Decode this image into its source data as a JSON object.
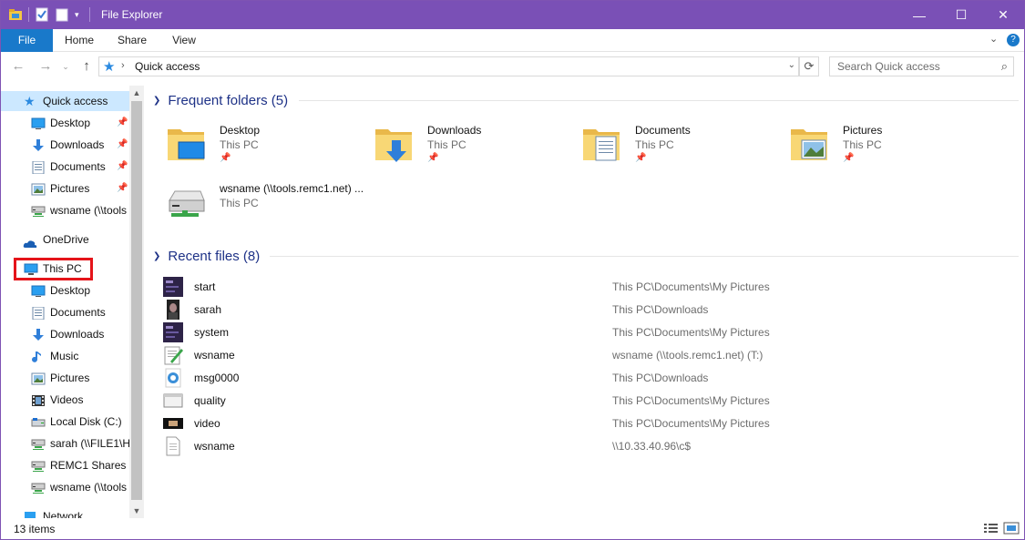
{
  "window": {
    "title": "File Explorer",
    "accent": "#7a50b6",
    "file_tab_color": "#1979ca",
    "highlight_color": "#e5141a",
    "controls": {
      "minimize": "—",
      "maximize": "☐",
      "close": "✕"
    }
  },
  "ribbon": {
    "tabs": [
      "File",
      "Home",
      "Share",
      "View"
    ],
    "expand_glyph": "⌄",
    "help_glyph": "?"
  },
  "address": {
    "path": "Quick access",
    "separator": "›",
    "search_placeholder": "Search Quick access"
  },
  "nav": {
    "quick_access": "Quick access",
    "qa_items": [
      {
        "label": "Desktop",
        "icon": "desktop-icon",
        "pinned": true
      },
      {
        "label": "Downloads",
        "icon": "downloads-icon",
        "pinned": true
      },
      {
        "label": "Documents",
        "icon": "documents-icon",
        "pinned": true
      },
      {
        "label": "Pictures",
        "icon": "pictures-icon",
        "pinned": true
      },
      {
        "label": "wsname (\\\\tools",
        "icon": "network-drive-icon",
        "pinned": false
      }
    ],
    "onedrive": "OneDrive",
    "this_pc": "This PC",
    "pc_items": [
      {
        "label": "Desktop",
        "icon": "desktop-icon"
      },
      {
        "label": "Documents",
        "icon": "documents-icon"
      },
      {
        "label": "Downloads",
        "icon": "downloads-icon"
      },
      {
        "label": "Music",
        "icon": "music-icon"
      },
      {
        "label": "Pictures",
        "icon": "pictures-icon"
      },
      {
        "label": "Videos",
        "icon": "videos-icon"
      },
      {
        "label": "Local Disk (C:)",
        "icon": "local-disk-icon"
      },
      {
        "label": "sarah (\\\\FILE1\\H",
        "icon": "network-drive-icon"
      },
      {
        "label": "REMC1 Shares (S",
        "icon": "network-drive-icon"
      },
      {
        "label": "wsname (\\\\tools",
        "icon": "network-drive-icon"
      }
    ],
    "network": "Network"
  },
  "frequent": {
    "title": "Frequent folders (5)",
    "folders": [
      {
        "name": "Desktop",
        "location": "This PC",
        "icon": "desktop-folder-icon"
      },
      {
        "name": "Downloads",
        "location": "This PC",
        "icon": "downloads-folder-icon"
      },
      {
        "name": "Documents",
        "location": "This PC",
        "icon": "documents-folder-icon"
      },
      {
        "name": "Pictures",
        "location": "This PC",
        "icon": "pictures-folder-icon"
      },
      {
        "name": "wsname (\\\\tools.remc1.net) ...",
        "location": "This PC",
        "icon": "network-drive-icon"
      }
    ]
  },
  "recent": {
    "title": "Recent files (8)",
    "files": [
      {
        "name": "start",
        "location": "This PC\\Documents\\My Pictures",
        "icon": "image-thumb-icon"
      },
      {
        "name": "sarah",
        "location": "This PC\\Downloads",
        "icon": "photo-thumb-icon"
      },
      {
        "name": "system",
        "location": "This PC\\Documents\\My Pictures",
        "icon": "image-thumb-icon"
      },
      {
        "name": "wsname",
        "location": "wsname (\\\\tools.remc1.net) (T:)",
        "icon": "notepad-file-icon"
      },
      {
        "name": "msg0000",
        "location": "This PC\\Downloads",
        "icon": "chrome-file-icon"
      },
      {
        "name": "quality",
        "location": "This PC\\Documents\\My Pictures",
        "icon": "window-thumb-icon"
      },
      {
        "name": "video",
        "location": "This PC\\Documents\\My Pictures",
        "icon": "video-thumb-icon"
      },
      {
        "name": "wsname",
        "location": "\\\\10.33.40.96\\c$",
        "icon": "text-file-icon"
      }
    ]
  },
  "status": {
    "item_count": "13 items"
  }
}
